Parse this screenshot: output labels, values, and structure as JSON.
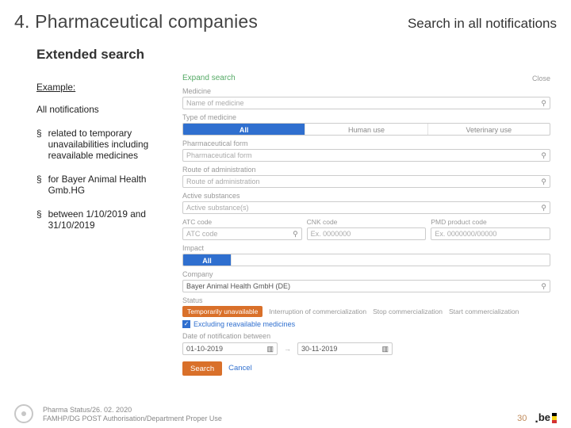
{
  "title": "4. Pharmaceutical companies",
  "subtitle": "Search in all notifications",
  "heading": "Extended search",
  "left": {
    "example": "Example:",
    "all": "All notifications",
    "b1": "related to temporary unavailabilities including reavailable medicines",
    "b2": "for Bayer Animal Health Gmb.HG",
    "b3": "between 1/10/2019 and 31/10/2019"
  },
  "form": {
    "expand": "Expand search",
    "close": "Close",
    "medicine_label": "Medicine",
    "medicine_ph": "Name of medicine",
    "type_label": "Type of medicine",
    "type_all": "All",
    "type_human": "Human use",
    "type_vet": "Veterinary use",
    "pharmform_label": "Pharmaceutical form",
    "pharmform_ph": "Pharmaceutical form",
    "route_label": "Route of administration",
    "route_ph": "Route of administration",
    "active_label": "Active substances",
    "active_ph": "Active substance(s)",
    "atc_label": "ATC code",
    "atc_ph": "ATC code",
    "cnk_label": "CNK code",
    "cnk_ph": "Ex. 0000000",
    "pmd_label": "PMD product code",
    "pmd_ph": "Ex. 0000000/00000",
    "impact_label": "Impact",
    "impact_val": "All",
    "company_label": "Company",
    "company_val": "Bayer Animal Health GmbH (DE)",
    "status_label": "Status",
    "status_chip": "Temporarily unavailable",
    "status_o1": "Interruption of commercialization",
    "status_o2": "Stop commercialization",
    "status_o3": "Start commercialization",
    "check": "Excluding reavailable medicines",
    "daterange_label": "Date of notification between",
    "date_from": "01-10-2019",
    "date_to": "30-11-2019",
    "btn_search": "Search",
    "btn_cancel": "Cancel"
  },
  "footer": {
    "line1": "Pharma Status/26. 02. 2020",
    "line2": "FAMHP/DG POST Authorisation/Department Proper Use",
    "page": "30",
    "be": "be"
  }
}
